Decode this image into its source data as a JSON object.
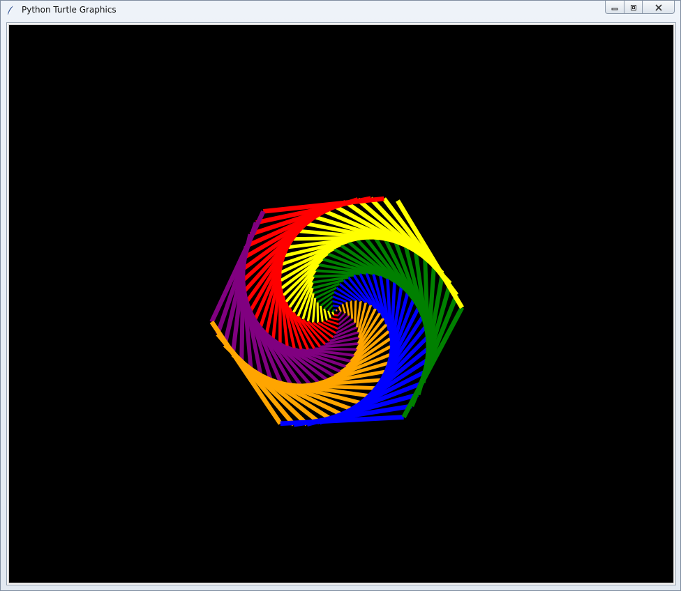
{
  "window": {
    "title": "Python Turtle Graphics",
    "app_icon": "feather-icon",
    "controls": {
      "minimize_icon": "minimize-icon",
      "maximize_icon": "maximize-icon",
      "close_icon": "close-icon"
    }
  },
  "canvas": {
    "background": "#000000",
    "pen_colors": [
      "red",
      "purple",
      "orange",
      "blue",
      "green",
      "yellow"
    ],
    "pen_colors_hex": [
      "#ff0000",
      "#800080",
      "#ffa500",
      "#0000ff",
      "#008000",
      "#ffff00"
    ]
  }
}
